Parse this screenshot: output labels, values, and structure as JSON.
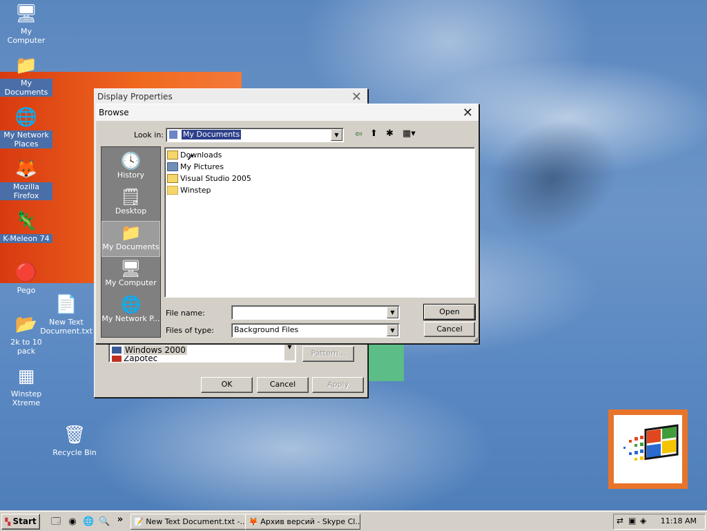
{
  "desktop": {
    "icons": [
      {
        "label": "My Computer",
        "icon": "my-computer-icon"
      },
      {
        "label": "My Documents",
        "icon": "my-documents-icon"
      },
      {
        "label": "My Network Places",
        "icon": "network-places-icon"
      },
      {
        "label": "Mozilla Firefox",
        "icon": "firefox-icon"
      },
      {
        "label": "K-Meleon 74",
        "icon": "k-meleon-icon"
      },
      {
        "label": "Pego",
        "icon": "pego-icon"
      },
      {
        "label": "New Text Document.txt",
        "icon": "text-document-icon"
      },
      {
        "label": "2k to 10 pack",
        "icon": "folder-icon"
      },
      {
        "label": "Winstep Xtreme",
        "icon": "winstep-icon"
      },
      {
        "label": "Recycle Bin",
        "icon": "recycle-bin-icon"
      }
    ]
  },
  "display_properties": {
    "title": "Display Properties",
    "list_items": [
      "Windows 2000",
      "Zapotec"
    ],
    "pattern_label": "Pattern...",
    "ok_label": "OK",
    "cancel_label": "Cancel",
    "apply_label": "Apply"
  },
  "browse": {
    "title": "Browse",
    "look_in_label": "Look in:",
    "look_in_value": "My Documents",
    "places": [
      "History",
      "Desktop",
      "My Documents",
      "My Computer",
      "My Network P..."
    ],
    "files": [
      {
        "name": "Downloads",
        "type": "folder"
      },
      {
        "name": "My Pictures",
        "type": "pictures-folder"
      },
      {
        "name": "Visual Studio 2005",
        "type": "folder"
      },
      {
        "name": "Winstep",
        "type": "shortcut-folder"
      }
    ],
    "file_name_label": "File name:",
    "file_name_value": "",
    "files_of_type_label": "Files of type:",
    "files_of_type_value": "Background Files",
    "open_label": "Open",
    "cancel_label": "Cancel"
  },
  "taskbar": {
    "start_label": "Start",
    "tasks": [
      "New Text Document.txt -...",
      "Архив версий - Skype Cl..."
    ],
    "clock": "11:18 AM"
  }
}
